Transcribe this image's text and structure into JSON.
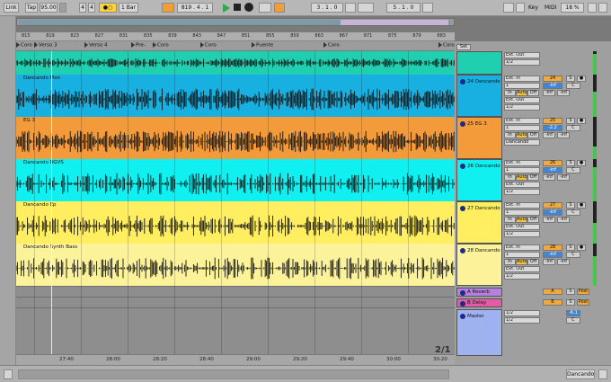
{
  "transport": {
    "link": "Link",
    "tap": "Tap",
    "tempo": "95.00",
    "sig_num": "4",
    "sig_den": "4",
    "metro": "1 Bar",
    "position": "819 . 4 . 1",
    "loop_start": "3 . 1 . 0",
    "loop_len": "5 . 1 . 0",
    "key": "Key",
    "midi": "MIDI",
    "cpu": "18 %"
  },
  "ruler_ticks": [
    "815",
    "819",
    "823",
    "827",
    "831",
    "835",
    "839",
    "843",
    "847",
    "851",
    "855",
    "859",
    "863",
    "867",
    "871",
    "875",
    "879",
    "883"
  ],
  "locators": [
    {
      "label": "Coro 2"
    },
    {
      "label": "Verso 3"
    },
    {
      "label": "Verso 4"
    },
    {
      "label": "Pre-"
    },
    {
      "label": "Coro"
    },
    {
      "label": "Coro"
    },
    {
      "label": "Puente"
    },
    {
      "label": "Coro"
    },
    {
      "label": "Coro"
    }
  ],
  "set_label": "Set",
  "tracks": [
    {
      "clip": "",
      "name": "",
      "color": "#1fcfb0",
      "input": "Ext. Out",
      "sub": "1/2",
      "number": "",
      "type": "group"
    },
    {
      "clip": "Dancando Pion",
      "name": "24 Dancando",
      "color": "#18b0e0",
      "input": "Ext. In",
      "chan": "1",
      "monitor": [
        "In",
        "Auto",
        "Off"
      ],
      "output": "Ext. Out",
      "outsub": "1/2",
      "number": "24",
      "pan": "C",
      "vol": "-inf",
      "vol2": "-inf"
    },
    {
      "clip": "EG 3",
      "name": "25 EG 3",
      "color": "#f39b3a",
      "input": "Ext. In",
      "chan": "1",
      "monitor": [
        "In",
        "Auto",
        "Off"
      ],
      "output": "Dancando",
      "outsub": "",
      "number": "25",
      "pan": "C",
      "vol": "-2.2",
      "vol2": "-inf"
    },
    {
      "clip": "Dancando BGVS",
      "name": "26 Dancando",
      "color": "#10f0f0",
      "input": "Ext. In",
      "chan": "1",
      "monitor": [
        "In",
        "Auto",
        "Off"
      ],
      "output": "Ext. Out",
      "outsub": "1/2",
      "number": "26",
      "pan": "C",
      "vol": "-inf",
      "vol2": "-inf"
    },
    {
      "clip": "Dancando Ep",
      "name": "27 Dancando",
      "color": "#ffee60",
      "input": "Ext. In",
      "chan": "1",
      "monitor": [
        "In",
        "Auto",
        "Off"
      ],
      "output": "Ext. Out",
      "outsub": "1/2",
      "number": "27",
      "pan": "C",
      "vol": "-inf",
      "vol2": "-inf"
    },
    {
      "clip": "Dancando Synth Bass",
      "name": "28 Dancando",
      "color": "#fbf29a",
      "input": "Ext. In",
      "chan": "1",
      "monitor": [
        "In",
        "Auto",
        "Off"
      ],
      "output": "Ext. Out",
      "outsub": "1/2",
      "number": "28",
      "pan": "C",
      "vol": "-inf",
      "vol2": "-inf"
    }
  ],
  "returns": [
    {
      "name": "A Reverb",
      "color": "#b77fe0",
      "letter": "A",
      "post": "Post"
    },
    {
      "name": "B Delay",
      "color": "#e45aa8",
      "letter": "B",
      "post": "Post"
    }
  ],
  "master": {
    "name": "Master",
    "color": "#9eb2f0",
    "output": "1/2",
    "output2": "1/2",
    "pan": "C",
    "vol": "-6.1"
  },
  "time_ticks": [
    "27:40",
    "28:00",
    "28:20",
    "28:40",
    "29:00",
    "29:20",
    "29:40",
    "30:00",
    "30:20"
  ],
  "beat_page": "2/1",
  "bottom_track": "Dancando",
  "colors": {
    "accent": "#f29e37",
    "play": "#2ea84a"
  }
}
